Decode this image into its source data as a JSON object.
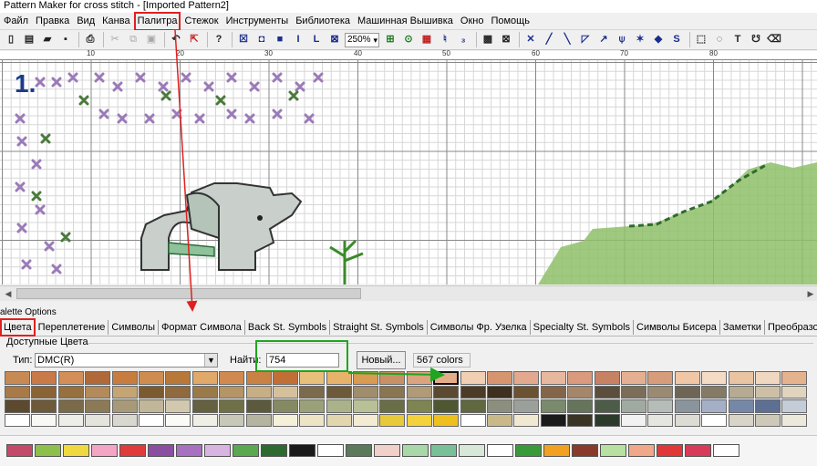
{
  "window": {
    "title": "Pattern Maker for cross stitch - [Imported Pattern2]"
  },
  "menu": {
    "items": [
      "Файл",
      "Правка",
      "Вид",
      "Канва",
      "Палитра",
      "Стежок",
      "Инструменты",
      "Библиотека",
      "Машинная Вышивка",
      "Окно",
      "Помощь"
    ],
    "highlight": "Палитра"
  },
  "toolbar": {
    "zoom": "250%"
  },
  "ruler": {
    "labels": [
      "10",
      "20",
      "30",
      "40",
      "50",
      "60",
      "70",
      "80"
    ]
  },
  "canvas": {
    "page_number": "1."
  },
  "palette": {
    "title": "alette Options",
    "tabs": [
      "Цвета",
      "Переплетение",
      "Символы",
      "Формат Символа",
      "Back St. Symbols",
      "Straight St. Symbols",
      "Символы Фр. Узелка",
      "Specialty St. Symbols",
      "Символы Бисера",
      "Заметки",
      "Преобразовать"
    ],
    "active_tab": "Цвета",
    "group_label": "Доступные Цвета",
    "type_label": "Тип:",
    "type_value": "DMC(R)",
    "find_label": "Найти:",
    "find_value": "754",
    "new_button": "Новый...",
    "color_count": "567 colors",
    "swatches": [
      "#c88a55",
      "#c87a48",
      "#d38f57",
      "#b06a3a",
      "#c77d40",
      "#cf8c4f",
      "#b8783a",
      "#e0a869",
      "#d08a50",
      "#ca8144",
      "#c26f37",
      "#e8c07c",
      "#e7b26b",
      "#d99a52",
      "#c99066",
      "#dba47e",
      "#e3ad88",
      "#f0cfb2",
      "#d6956f",
      "#e3a98f",
      "#e8b89e",
      "#d99a7e",
      "#c78163",
      "#e5b091",
      "#d79c7a",
      "#efc7a6",
      "#f3dcc3",
      "#e9c4a2",
      "#f0d7c0",
      "#e5b28e",
      "#a87a48",
      "#8a6434",
      "#96703d",
      "#b38a5a",
      "#c6a575",
      "#7c5a30",
      "#8e6a3e",
      "#9b7a4a",
      "#b59466",
      "#c8ae85",
      "#d6c09c",
      "#7b6a4c",
      "#6d5a3a",
      "#a08d6c",
      "#8a7552",
      "#b09a78",
      "#5b4a31",
      "#4c3c26",
      "#3d3020",
      "#6b5232",
      "#83664a",
      "#a5866a",
      "#5c4e3c",
      "#7c6d58",
      "#9a8a72",
      "#6e6555",
      "#847a66",
      "#b6aa92",
      "#cdbfa6",
      "#e1d4be",
      "#5c4a2e",
      "#6c5a3a",
      "#7a6a48",
      "#8c7a56",
      "#a89a78",
      "#c2b698",
      "#d2c8ae",
      "#646040",
      "#707048",
      "#5c5a3c",
      "#858a62",
      "#9aa078",
      "#aab28a",
      "#b8c096",
      "#6a6e46",
      "#7e8452",
      "#4f5632",
      "#606840",
      "#8c8e7e",
      "#9ca09a",
      "#7a8a6c",
      "#65745a",
      "#4c5c48",
      "#a0aaa0",
      "#b6bcb8",
      "#8a949c",
      "#a3b0c8",
      "#7688a8",
      "#5d6f92",
      "#c4ccd8",
      "#ffffff",
      "#f8f8f4",
      "#eeeee8",
      "#e4e4dc",
      "#d8d8d0",
      "#ffffff",
      "#fafaf6",
      "#f0efe6",
      "#c8c8b8",
      "#b4b4a0",
      "#f5f0d8",
      "#ece4c4",
      "#e1d6ae",
      "#f3ecd2",
      "#e8c93a",
      "#f3d23b",
      "#efbf1d",
      "#ffffff",
      "#c9b98a",
      "#f1e8d2",
      "#1a1a1a",
      "#3a3424",
      "#2c3a2c",
      "#f2f2f2",
      "#e6e6e0",
      "#dcdcd4",
      "#ffffff",
      "#d8d4c8",
      "#cec8b8",
      "#ece8dc"
    ],
    "selected_swatch": 16,
    "used_colors": [
      "#c44a6a",
      "#8cc04a",
      "#f0d840",
      "#f4a4c4",
      "#e03a3a",
      "#8a4fa0",
      "#a870c0",
      "#d8b4e0",
      "#5aa850",
      "#2c6a30",
      "#1a1a1a",
      "#ffffff",
      "#5a7a5a",
      "#f0d0c8",
      "#a8d8a8",
      "#78c098",
      "#d8e8d8",
      "#ffffff",
      "#3a9a3a",
      "#f2a020",
      "#8a3a2a",
      "#b8e0a0",
      "#f0a888",
      "#e03838",
      "#d83a5a",
      "#ffffff"
    ]
  }
}
